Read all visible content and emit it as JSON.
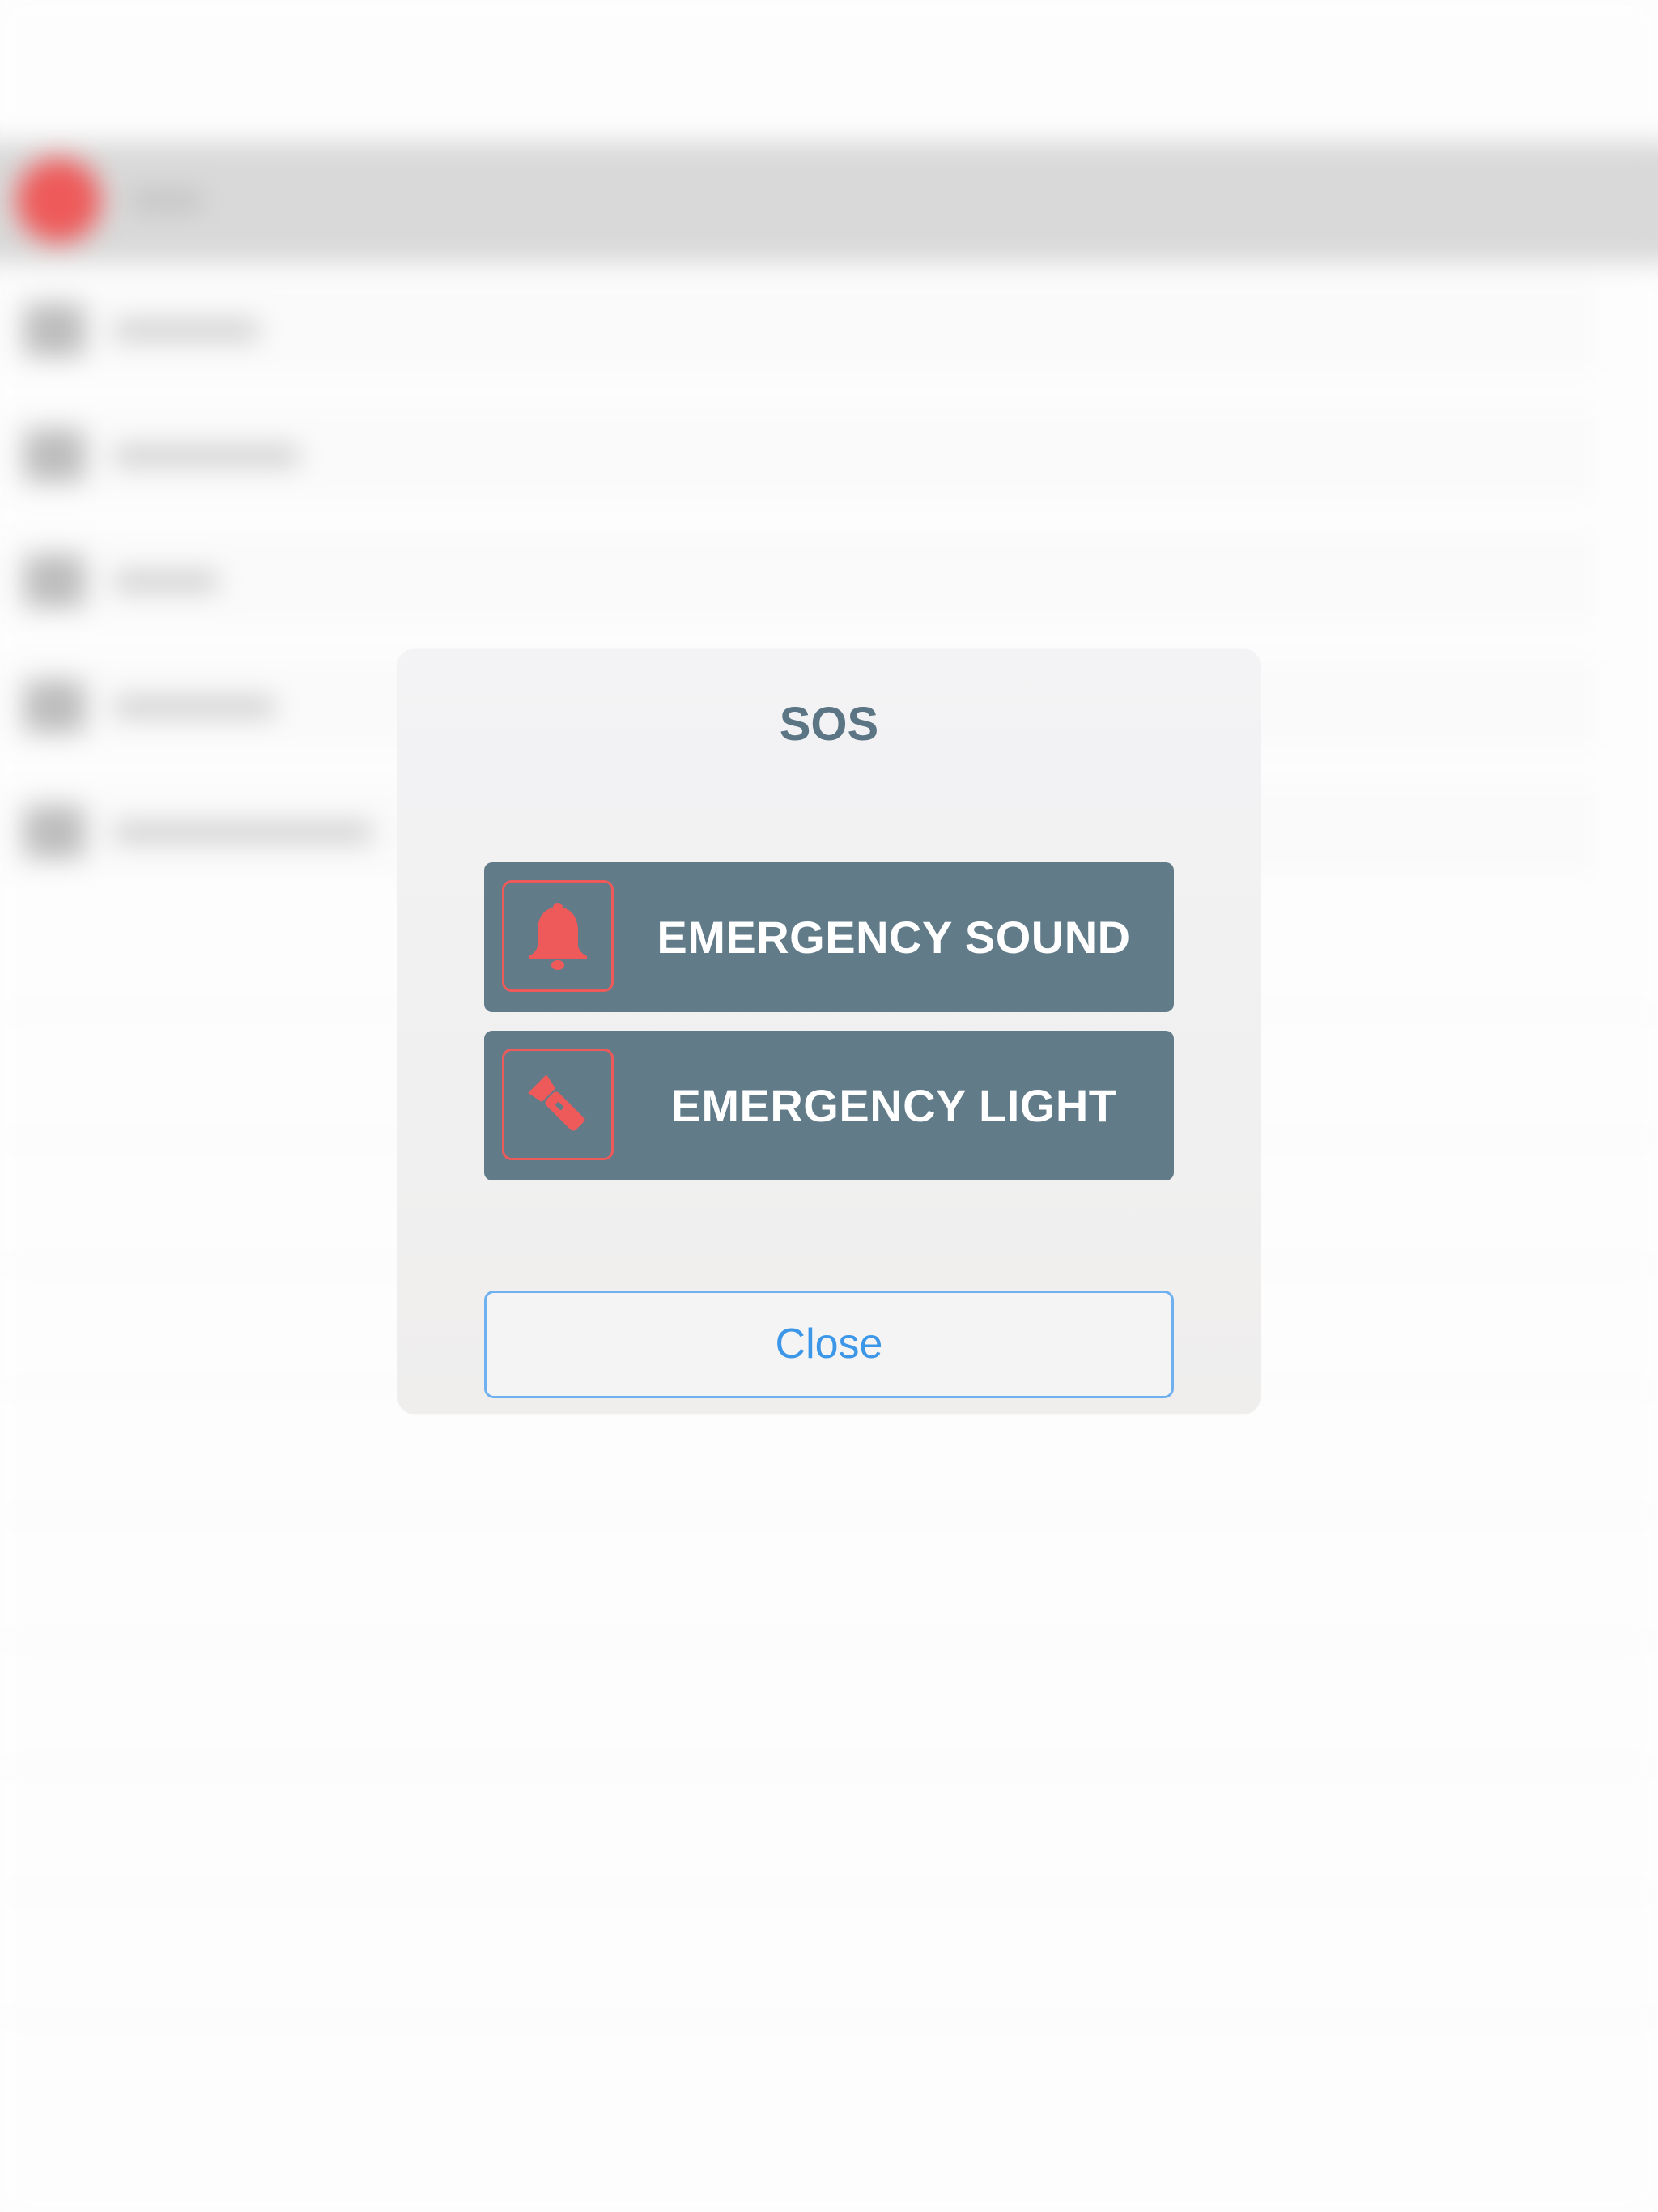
{
  "modal": {
    "title": "SOS",
    "buttons": [
      {
        "label": "EMERGENCY SOUND",
        "icon": "bell-icon"
      },
      {
        "label": "EMERGENCY LIGHT",
        "icon": "flashlight-icon"
      }
    ],
    "close_label": "Close"
  },
  "colors": {
    "button_bg": "#617b89",
    "icon_accent": "#ee5a5a",
    "title_text": "#5b7585",
    "close_text": "#3d97e8",
    "close_border": "#6fb0f0"
  }
}
